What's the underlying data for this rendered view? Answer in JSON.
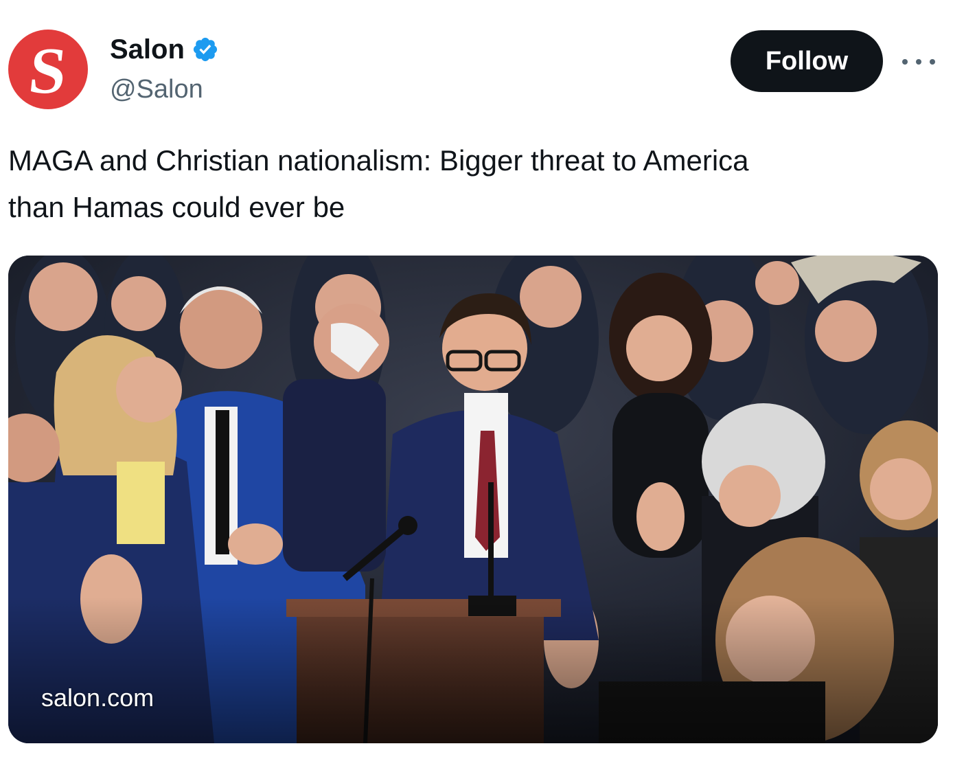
{
  "account": {
    "display_name": "Salon",
    "handle": "@Salon",
    "avatar_letter": "S",
    "avatar_color": "#e23b3b",
    "verified": true,
    "verified_color": "#1d9bf0"
  },
  "actions": {
    "follow_label": "Follow",
    "more_icon": "more-horizontal-icon"
  },
  "tweet": {
    "text_line1": "MAGA and Christian nationalism: Bigger threat to America",
    "text_line2": "than Hamas could ever be"
  },
  "link_card": {
    "domain": "salon.com"
  }
}
